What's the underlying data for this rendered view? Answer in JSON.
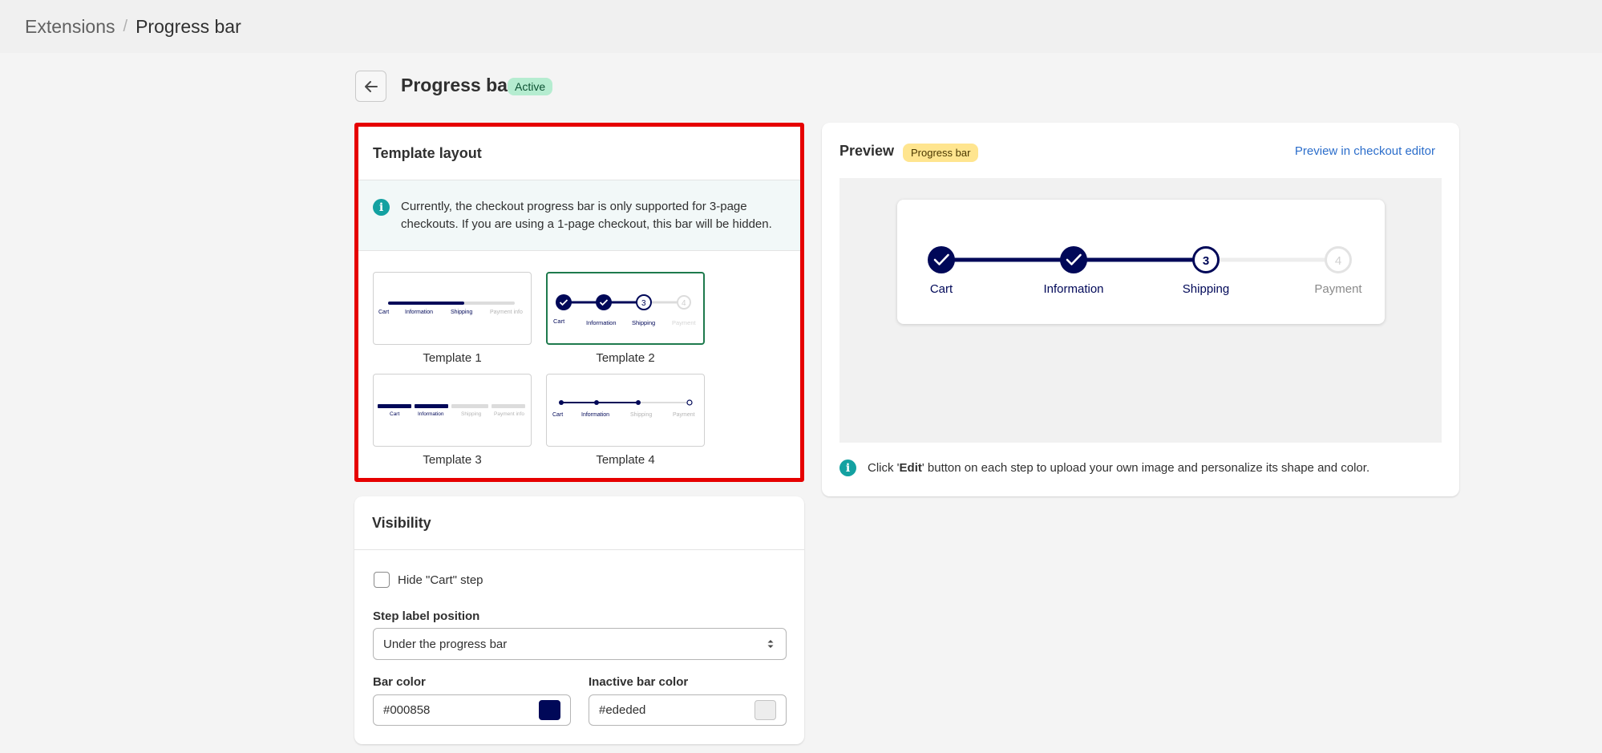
{
  "breadcrumb": {
    "parent": "Extensions",
    "separator": "/",
    "current": "Progress bar"
  },
  "page": {
    "title": "Progress bar",
    "status_badge": "Active"
  },
  "template_layout": {
    "title": "Template layout",
    "info_text": "Currently, the checkout progress bar is only supported for 3-page checkouts. If you are using a 1-page checkout, this bar will be hidden.",
    "selected_template": "Template 2",
    "templates": [
      {
        "label": "Template 1",
        "steps": [
          "Cart",
          "Information",
          "Shipping",
          "Payment info"
        ],
        "progress_percent": 60
      },
      {
        "label": "Template 2",
        "steps": [
          "Cart",
          "Information",
          "Shipping",
          "Payment"
        ],
        "current_step": 3
      },
      {
        "label": "Template 3",
        "steps": [
          "Cart",
          "Information",
          "Shipping",
          "Payment info"
        ],
        "completed_steps": 2
      },
      {
        "label": "Template 4",
        "steps": [
          "Cart",
          "Information",
          "Shipping",
          "Payment"
        ],
        "completed_steps": 3
      }
    ]
  },
  "visibility": {
    "title": "Visibility",
    "hide_cart_label": "Hide \"Cart\" step",
    "hide_cart_checked": false,
    "step_label_position_label": "Step label position",
    "step_label_position_value": "Under the progress bar",
    "bar_color_label": "Bar color",
    "bar_color_value": "#000858",
    "inactive_bar_color_label": "Inactive bar color",
    "inactive_bar_color_value": "#ededed"
  },
  "preview": {
    "title": "Preview",
    "badge": "Progress bar",
    "link": "Preview in checkout editor",
    "steps": [
      {
        "label": "Cart",
        "state": "completed"
      },
      {
        "label": "Information",
        "state": "completed"
      },
      {
        "label": "Shipping",
        "state": "current",
        "number": "3"
      },
      {
        "label": "Payment",
        "state": "inactive",
        "number": "4"
      }
    ],
    "note_prefix": "Click '",
    "note_bold": "Edit",
    "note_suffix": "' button on each step to upload your own image and personalize its shape and color."
  },
  "colors": {
    "active": "#000858",
    "inactive": "#ededed",
    "highlight_border": "#e60000",
    "selected_border": "#1e7a4d",
    "info_icon": "#13a1a1",
    "link": "#2c6ecb"
  },
  "icons": {
    "back": "arrow-left-icon",
    "info": "info-icon",
    "check": "check-icon",
    "select": "select-arrows-icon"
  }
}
